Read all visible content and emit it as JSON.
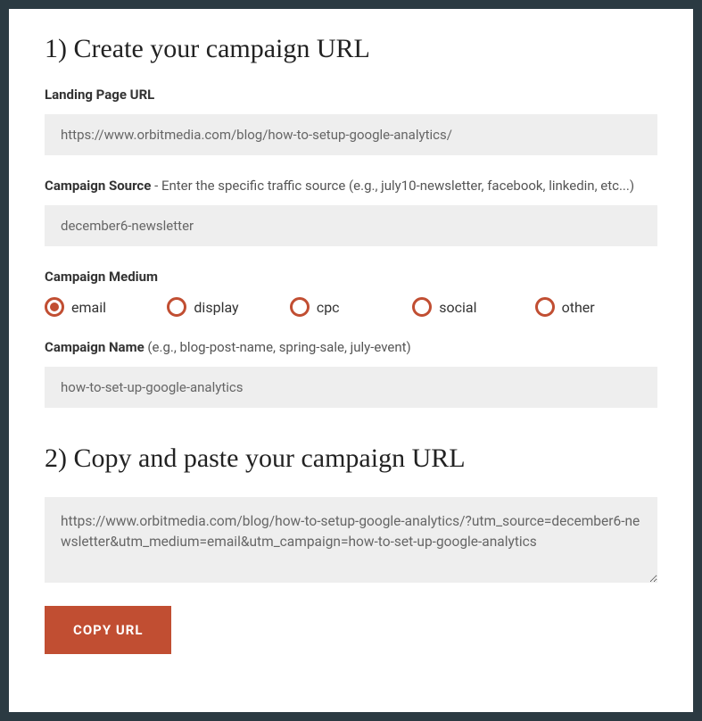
{
  "section1": {
    "heading": "1) Create your campaign URL",
    "landing_page": {
      "label": "Landing Page URL",
      "value": "https://www.orbitmedia.com/blog/how-to-setup-google-analytics/"
    },
    "campaign_source": {
      "label": "Campaign Source",
      "hint": " - Enter the specific traffic source (e.g., july10-newsletter, facebook, linkedin, etc...)",
      "value": "december6-newsletter"
    },
    "campaign_medium": {
      "label": "Campaign Medium",
      "selected": "email",
      "options": {
        "email": "email",
        "display": "display",
        "cpc": "cpc",
        "social": "social",
        "other": "other"
      }
    },
    "campaign_name": {
      "label": "Campaign Name",
      "hint": " (e.g., blog-post-name, spring-sale, july-event)",
      "value": "how-to-set-up-google-analytics"
    }
  },
  "section2": {
    "heading": "2) Copy and paste your campaign URL",
    "output": "https://www.orbitmedia.com/blog/how-to-setup-google-analytics/?utm_source=december6-newsletter&utm_medium=email&utm_campaign=how-to-set-up-google-analytics",
    "copy_button": "COPY URL"
  }
}
